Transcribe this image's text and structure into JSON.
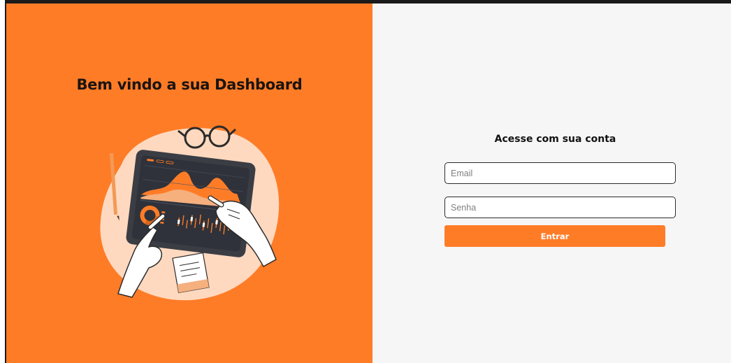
{
  "hero": {
    "title": "Bem vindo a sua Dashboard",
    "illustration": "tablet-dashboard-illustration"
  },
  "login": {
    "title": "Acesse com sua conta",
    "email": {
      "placeholder": "Email",
      "value": ""
    },
    "password": {
      "placeholder": "Senha",
      "value": ""
    },
    "submit_label": "Entrar"
  },
  "colors": {
    "brand": "#ff7c27",
    "panel_bg": "#f6f6f6",
    "text_dark": "#111111"
  }
}
